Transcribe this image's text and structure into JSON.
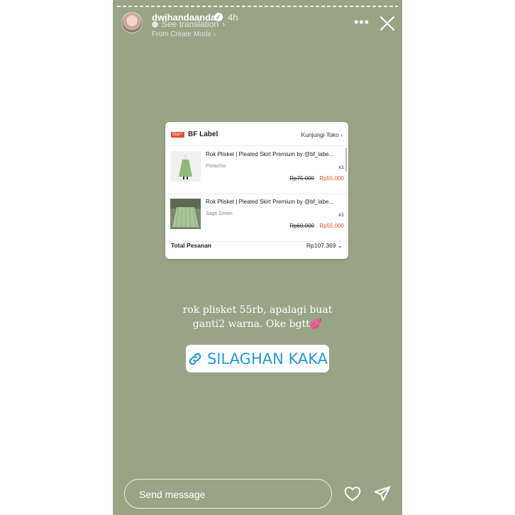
{
  "header": {
    "username": "dwihandaanda",
    "time": "4h",
    "see_translation": "See translation",
    "create_mode": "From Create Mode"
  },
  "order_card": {
    "badge": "Star+",
    "shop_name": "BF Label",
    "visit_shop": "Kunjungi Toko",
    "items": [
      {
        "title": "Rok Plisket | Pleated Skirt Premium by @bf_labe...",
        "variant": "Pistachio",
        "qty": "x1",
        "old_price": "Rp75.000",
        "new_price": "Rp55.000"
      },
      {
        "title": "Rok Plisket | Pleated Skirt Premium by @bf_labe...",
        "variant": "Sage Green",
        "qty": "x1",
        "old_price": "Rp60.000",
        "new_price": "Rp55.000"
      }
    ],
    "total_label": "Total Pesanan",
    "total_value": "Rp107.369"
  },
  "caption": {
    "line1": "rok plisket 55rb, apalagi buat",
    "line2": "ganti2 warna. Oke bgtt",
    "emoji": "💕"
  },
  "link_sticker": {
    "label": "SILAGHAN KAKA"
  },
  "footer": {
    "send_message_placeholder": "Send message"
  },
  "colors": {
    "background": "#98a486",
    "price_accent": "#ee4d2d",
    "link_blue": "#1f9ad8"
  },
  "icons": [
    "verified-icon",
    "globe-icon",
    "more-icon",
    "close-icon",
    "chevron-right-icon",
    "link-icon",
    "heart-icon",
    "send-icon"
  ]
}
